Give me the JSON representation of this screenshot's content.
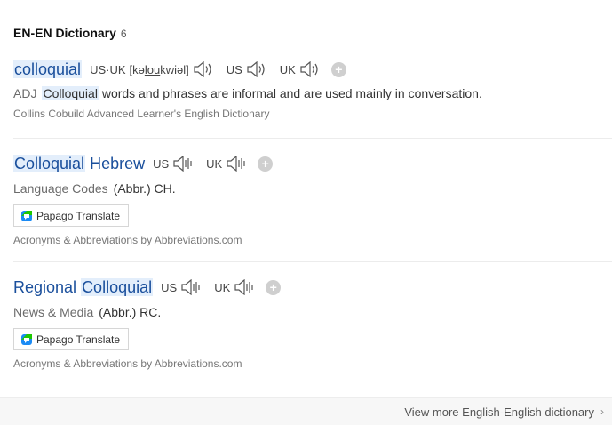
{
  "header": {
    "title": "EN-EN Dictionary",
    "count": "6"
  },
  "entries": [
    {
      "head_highlight": "colloquial",
      "head_rest": "",
      "pron_main_label": "US·UK",
      "ipa_open": "[kə",
      "ipa_under": "lou",
      "ipa_close": "kwiəl]",
      "us_label": "US",
      "uk_label": "UK",
      "pos": "ADJ",
      "def_highlight": "Colloquial",
      "def_rest": " words and phrases are informal and are used mainly in conversation.",
      "source": "Collins Cobuild Advanced Learner's English Dictionary"
    },
    {
      "head_highlight": "Colloquial",
      "head_rest": " Hebrew",
      "us_label": "US",
      "uk_label": "UK",
      "category": "Language Codes",
      "abbr": "(Abbr.) CH.",
      "papago": "Papago Translate",
      "source": "Acronyms & Abbreviations by Abbreviations.com"
    },
    {
      "head_pre": "Regional ",
      "head_highlight": "Colloquial",
      "us_label": "US",
      "uk_label": "UK",
      "category": "News & Media",
      "abbr": "(Abbr.) RC.",
      "papago": "Papago Translate",
      "source": "Acronyms & Abbreviations by Abbreviations.com"
    }
  ],
  "footer": {
    "more_label": "View more English-English dictionary",
    "chevron": "›"
  },
  "icons": {
    "add": "+",
    "speaker": "speaker-icon",
    "papago_logo": "papago-logo-icon"
  },
  "colors": {
    "headword": "#1a4f9c",
    "highlight": "#e3eefb",
    "papago_green": "#1ec800",
    "papago_blue": "#1b8bf5"
  }
}
